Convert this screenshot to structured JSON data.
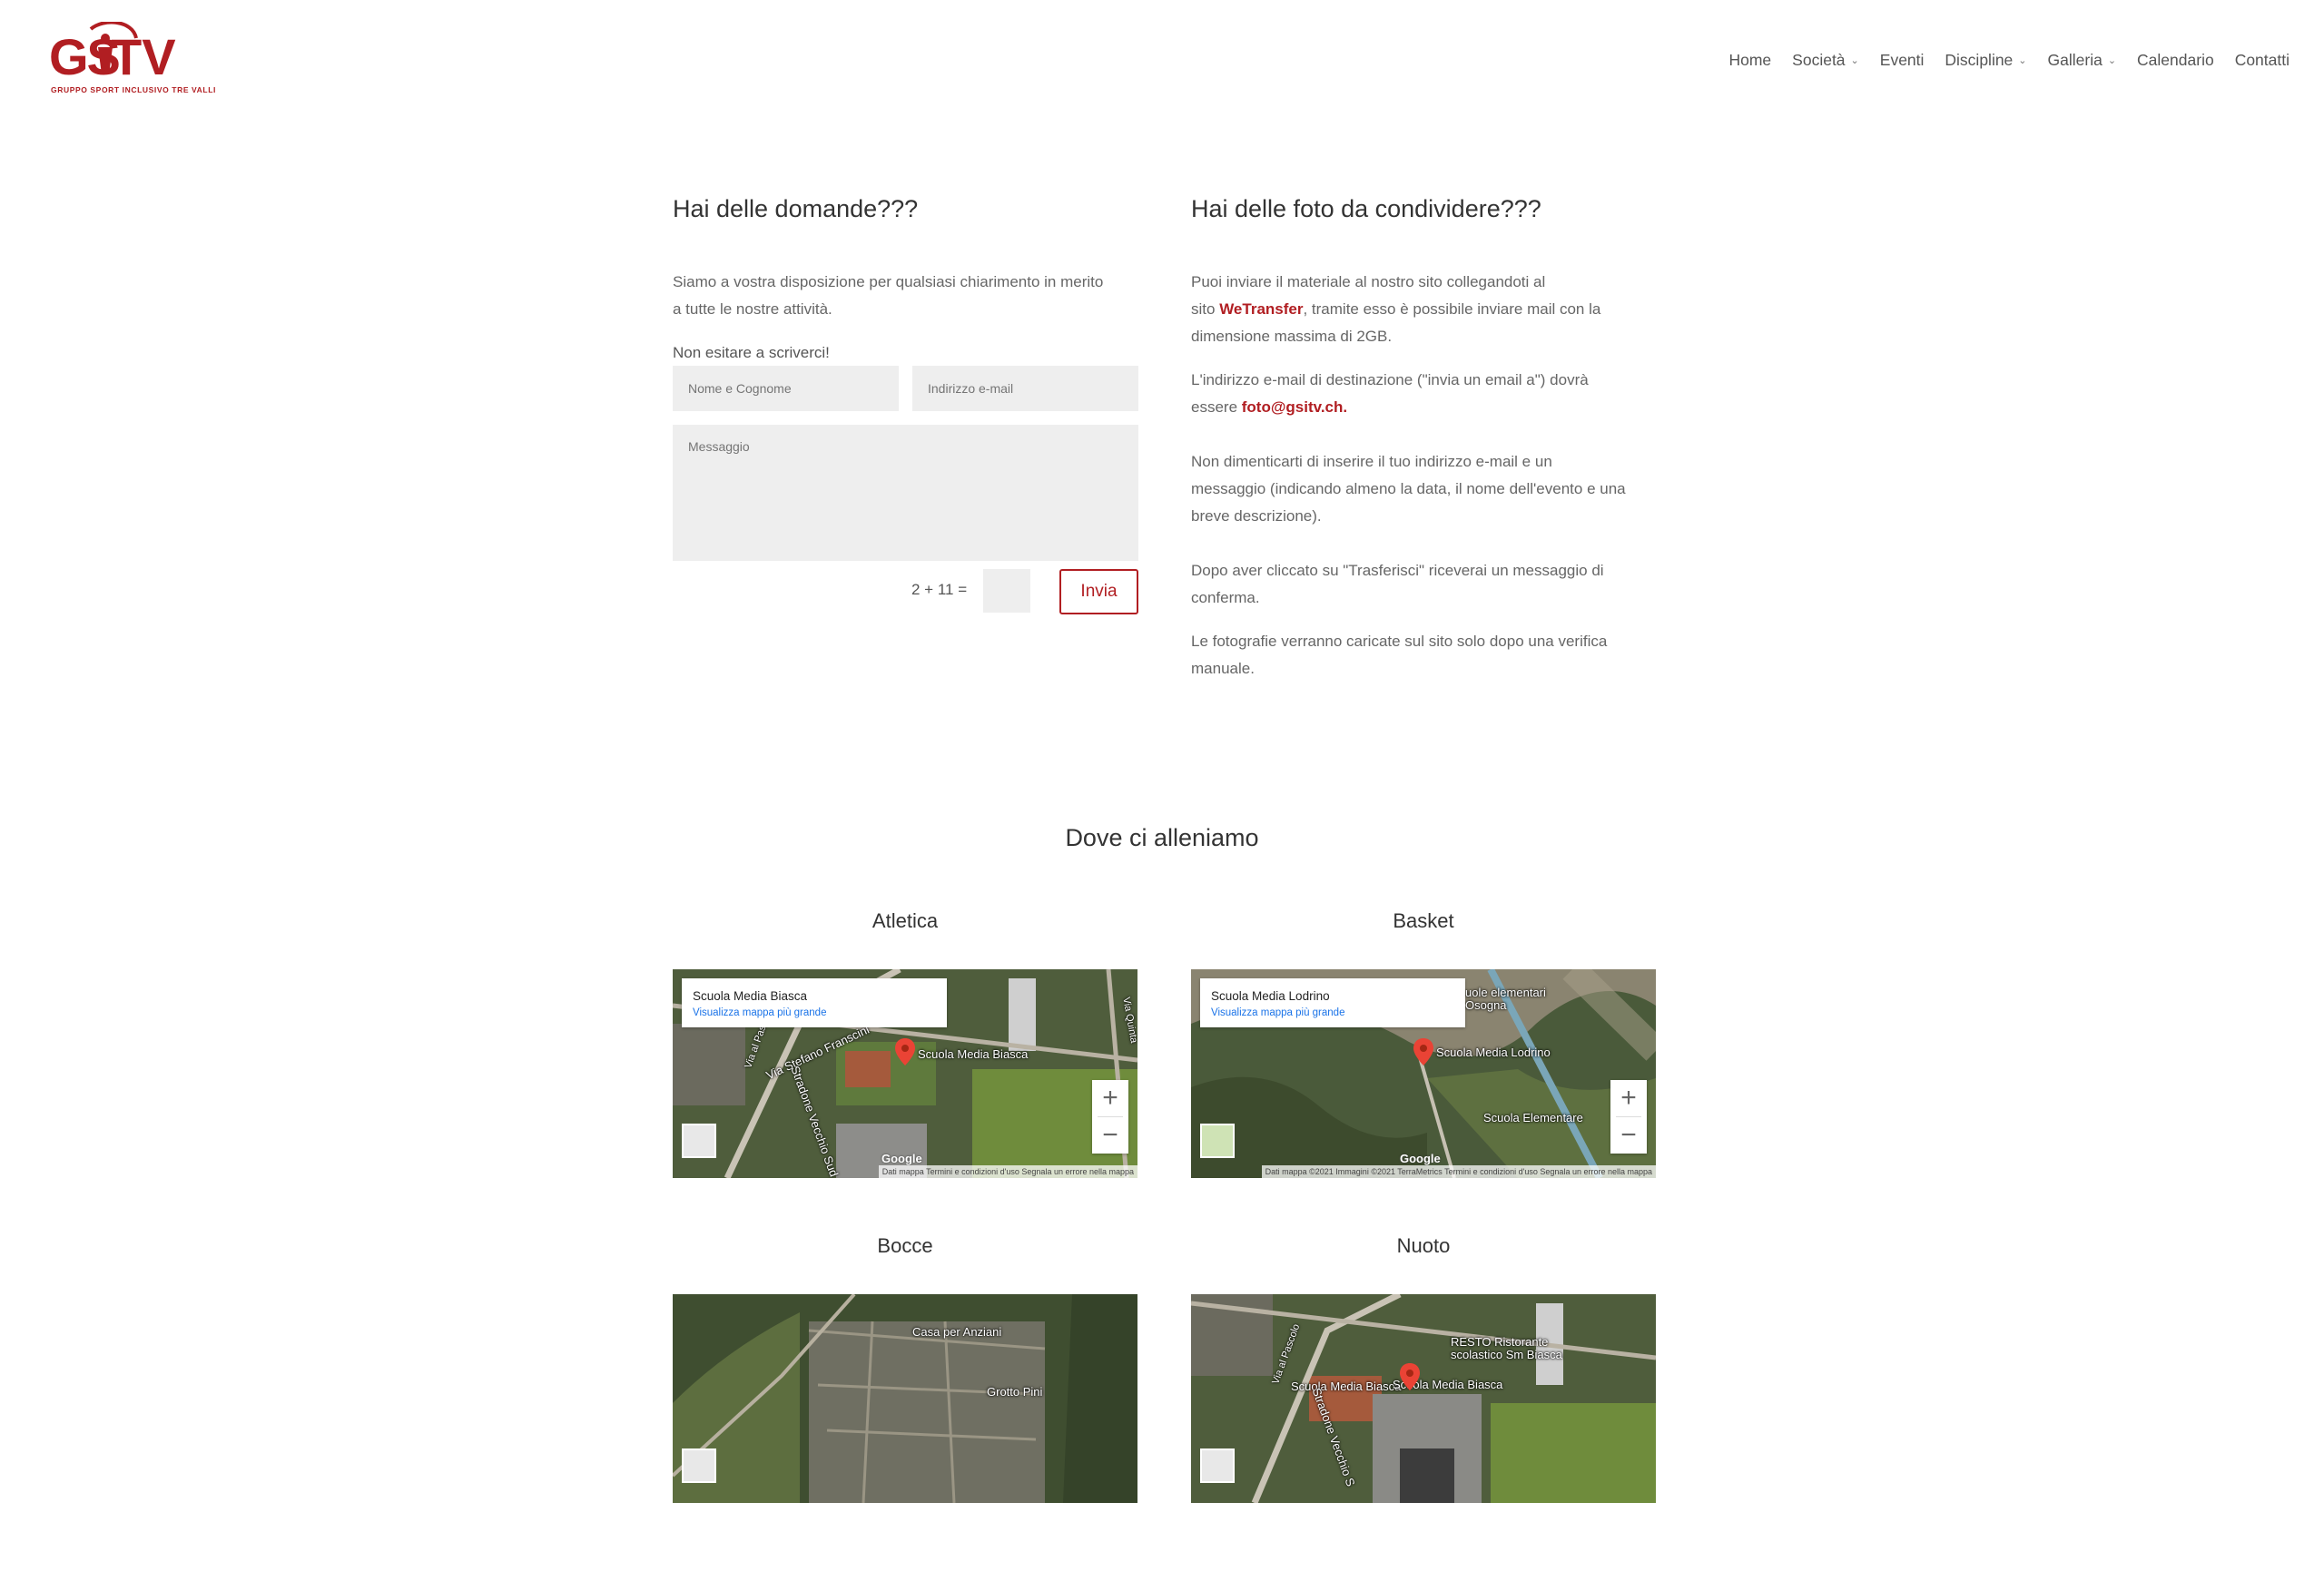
{
  "header": {
    "logo_text": "GSITV",
    "logo_sub": "GRUPPO SPORT INCLUSIVO TRE VALLI",
    "nav": [
      {
        "label": "Home",
        "has_dropdown": false
      },
      {
        "label": "Società",
        "has_dropdown": true
      },
      {
        "label": "Eventi",
        "has_dropdown": false
      },
      {
        "label": "Discipline",
        "has_dropdown": true
      },
      {
        "label": "Galleria",
        "has_dropdown": true
      },
      {
        "label": "Calendario",
        "has_dropdown": false
      },
      {
        "label": "Contatti",
        "has_dropdown": false
      }
    ]
  },
  "contact": {
    "title": "Hai delle domande???",
    "intro_line1": "Siamo a vostra disposizione per qualsiasi chiarimento in merito",
    "intro_line2": "a tutte le nostre attività.",
    "cta": "Non esitare a scriverci!",
    "name_placeholder": "Nome e Cognome",
    "email_placeholder": "Indirizzo e-mail",
    "message_placeholder": "Messaggio",
    "captcha_question": "2 + 11 =",
    "send_label": "Invia"
  },
  "photos": {
    "title": "Hai delle foto da condividere???",
    "p1_line1": "Puoi inviare il materiale al nostro sito collegandoti al",
    "p1_pre": "sito ",
    "p1_link": "WeTransfer",
    "p1_post": ", tramite esso è possibile inviare mail con la",
    "p1_line3": "dimensione massima di 2GB.",
    "p2_line1": "L'indirizzo e-mail di destinazione (\"invia un email a\") dovrà",
    "p2_pre": "essere ",
    "p2_link": "foto@gsitv.ch.",
    "p3_line1": "Non dimenticarti di inserire il tuo indirizzo e-mail e un",
    "p3_line2": "messaggio (indicando almeno la data, il nome dell'evento e una",
    "p3_line3": "breve descrizione).",
    "p4_line1": "Dopo aver cliccato su \"Trasferisci\" riceverai un messaggio di",
    "p4_line2": "conferma.",
    "p5_line1": "Le fotografie verranno caricate sul sito solo dopo una verifica",
    "p5_line2": "manuale."
  },
  "locations": {
    "title": "Dove ci alleniamo",
    "maps": [
      {
        "title": "Atletica",
        "card_name": "Scuola Media Biasca",
        "card_link": "Visualizza mappa più grande",
        "pin_label": "Scuola Media Biasca",
        "road1": "Via Stefano Franscini",
        "road2": "Stradone Vecchio Sud",
        "road3": "Via al Pascolo",
        "road4": "Via Quinta",
        "attribution": "Dati mappa   Termini e condizioni d'uso   Segnala un errore nella mappa",
        "google": "Google"
      },
      {
        "title": "Basket",
        "card_name": "Scuola Media Lodrino",
        "card_link": "Visualizza mappa più grande",
        "pin_label": "Scuola Media Lodrino",
        "label2": "Scuola Elementare",
        "label3": "uole elementari",
        "label4": "Osogna",
        "attribution": "Dati mappa ©2021 Immagini ©2021 TerraMetrics   Termini e condizioni d'uso   Segnala un errore nella mappa",
        "google": "Google"
      },
      {
        "title": "Bocce",
        "label1": "Casa per Anziani",
        "label2": "Grotto Pini"
      },
      {
        "title": "Nuoto",
        "label1": "RESTO Ristorante scolastico Sm Biasca",
        "label2": "Scuola Media Biasca",
        "label3": "Scuola Media Biasca",
        "road1": "Via al Pascolo",
        "road2": "Stradone Vecchio S"
      }
    ]
  },
  "colors": {
    "brand_red": "#b11e22",
    "field_bg": "#eeeeee",
    "link_blue": "#1a73e8"
  }
}
